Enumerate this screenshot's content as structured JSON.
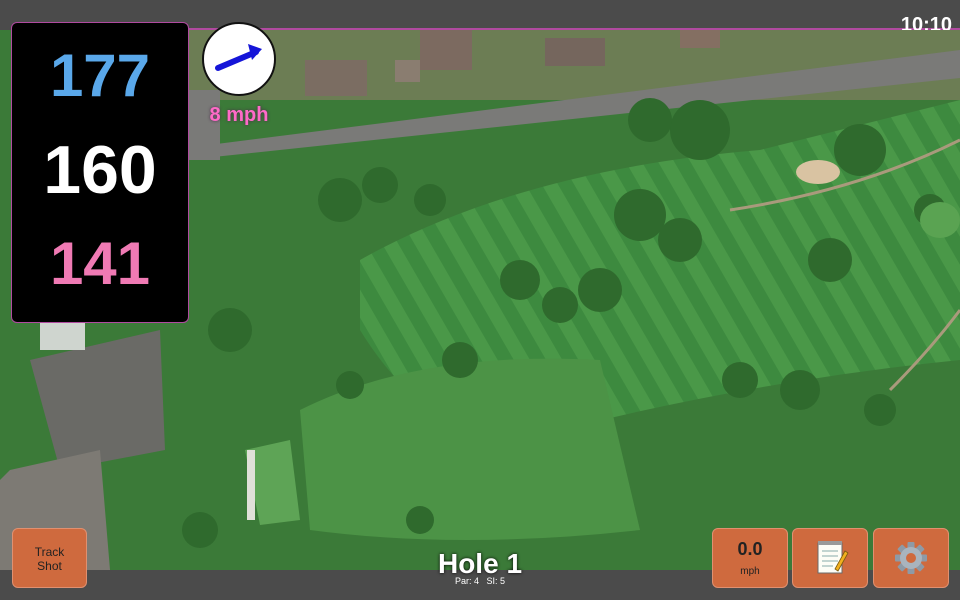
{
  "status": {
    "time": "10:10"
  },
  "distances": {
    "back": "177",
    "middle": "160",
    "front": "141"
  },
  "wind": {
    "speed_label": "8 mph",
    "arrow_icon": "wind-direction-arrow-icon",
    "direction": "east-northeast"
  },
  "hole": {
    "title": "Hole 1",
    "par_label": "Par: 4",
    "si_label": "SI: 5"
  },
  "buttons": {
    "track_shot_line1": "Track",
    "track_shot_line2": "Shot",
    "speed_value": "0.0",
    "speed_unit": "mph",
    "notes_icon": "notepad-icon",
    "settings_icon": "gear-icon"
  },
  "colors": {
    "back": "#5aa8ea",
    "middle": "#ffffff",
    "front": "#f07ab4",
    "wind": "#ff6ac8",
    "button": "#cf6a3e",
    "accent": "#b04aa0"
  }
}
